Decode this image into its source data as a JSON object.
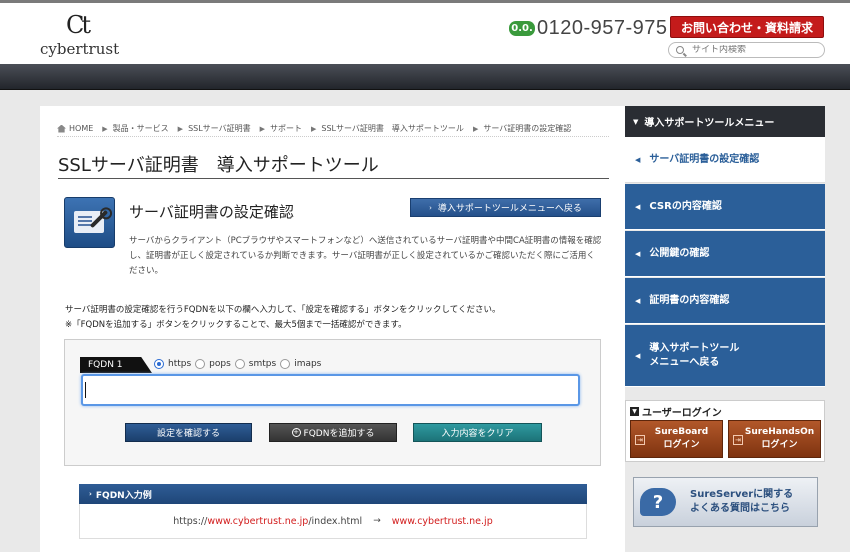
{
  "header": {
    "logo_mark": "Ct",
    "logo_text": "cybertrust",
    "freedial_label": "0.0.",
    "phone": "0120-957-975",
    "contact_button": "お問い合わせ・資料請求",
    "search_placeholder": "サイト内検索"
  },
  "breadcrumb": [
    "HOME",
    "製品・サービス",
    "SSLサーバ証明書",
    "サポート",
    "SSLサーバ証明書　導入サポートツール",
    "サーバ証明書の設定確認"
  ],
  "main": {
    "page_title": "SSLサーバ証明書　導入サポートツール",
    "section_title": "サーバ証明書の設定確認",
    "back_button": "導入サポートツールメニューへ戻る",
    "description": "サーバからクライアント（PCブラウザやスマートフォンなど）へ送信されているサーバ証明書や中間CA証明書の情報を確認し、証明書が正しく設定されているか判断できます。サーバ証明書が正しく設定されているかご確認いただく際にご活用ください。",
    "instruction_1": "サーバ証明書の設定確認を行うFQDNを以下の欄へ入力して、「設定を確認する」ボタンをクリックしてください。",
    "instruction_2": "※「FQDNを追加する」ボタンをクリックすることで、最大5個まで一括確認ができます。"
  },
  "form": {
    "fqdn_label": "FQDN 1",
    "protocols": [
      {
        "label": "https",
        "checked": true
      },
      {
        "label": "pops",
        "checked": false
      },
      {
        "label": "smtps",
        "checked": false
      },
      {
        "label": "imaps",
        "checked": false
      }
    ],
    "fqdn_value": "",
    "confirm_button": "設定を確認する",
    "add_button": "FQDNを追加する",
    "clear_button": "入力内容をクリア"
  },
  "example": {
    "title": "FQDN入力例",
    "input_prefix": "https://",
    "input_domain": "www.cybertrust.ne.jp",
    "input_suffix": "/index.html",
    "arrow": "→",
    "output": "www.cybertrust.ne.jp"
  },
  "sidebar": {
    "menu_title": "導入サポートツールメニュー",
    "items": [
      {
        "label": "サーバ証明書の設定確認",
        "active": true
      },
      {
        "label": "CSRの内容確認",
        "active": false
      },
      {
        "label": "公開鍵の確認",
        "active": false
      },
      {
        "label": "証明書の内容確認",
        "active": false
      },
      {
        "label_line1": "導入サポートツール",
        "label_line2": "メニューへ戻る",
        "active": false
      }
    ],
    "login_title": "ユーザーログイン",
    "login_buttons": [
      {
        "name": "SureBoard",
        "sub": "ログイン"
      },
      {
        "name": "SureHandsOn",
        "sub": "ログイン"
      }
    ],
    "faq_line1": "SureServerに関する",
    "faq_line2": "よくある質問はこちら"
  },
  "colors": {
    "brand_blue": "#2b5f99",
    "contact_red": "#c41b1b",
    "link_red": "#d21d1d"
  }
}
